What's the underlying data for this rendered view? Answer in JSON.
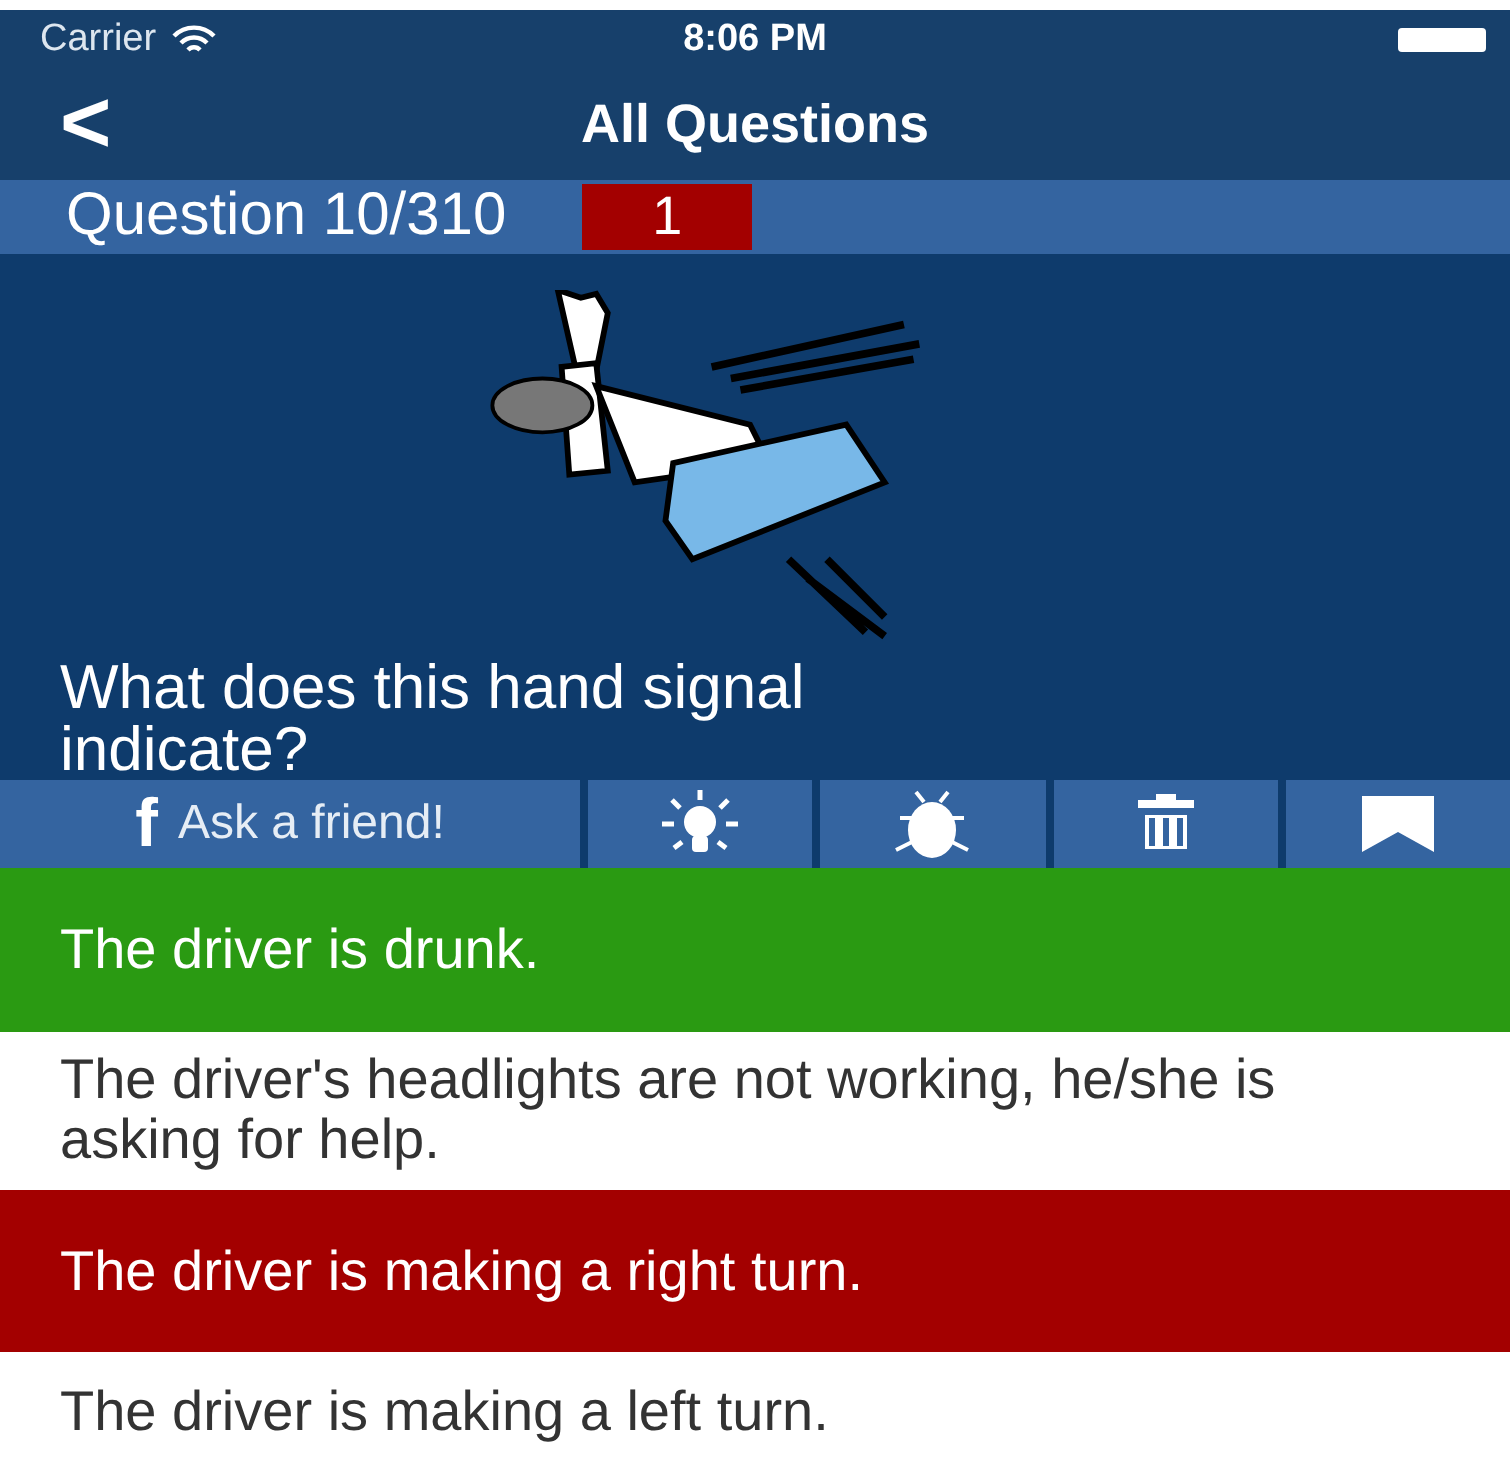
{
  "status_bar": {
    "carrier": "Carrier",
    "time": "8:06 PM"
  },
  "nav": {
    "back": "<",
    "title": "All Questions"
  },
  "question_bar": {
    "counter": "Question 10/310",
    "badge": "1"
  },
  "question": {
    "text": "What does this hand signal indicate?"
  },
  "toolbar": {
    "ask_friend": {
      "icon_char": "f",
      "label": "Ask a friend!"
    }
  },
  "answers": [
    {
      "text": "The driver is drunk.",
      "kind": "correct"
    },
    {
      "text": "The driver's headlights are not working, he/she is asking for help.",
      "kind": "plain"
    },
    {
      "text": "The driver is making a right turn.",
      "kind": "wrong"
    },
    {
      "text": "The driver is making a left turn.",
      "kind": "plain"
    }
  ]
}
